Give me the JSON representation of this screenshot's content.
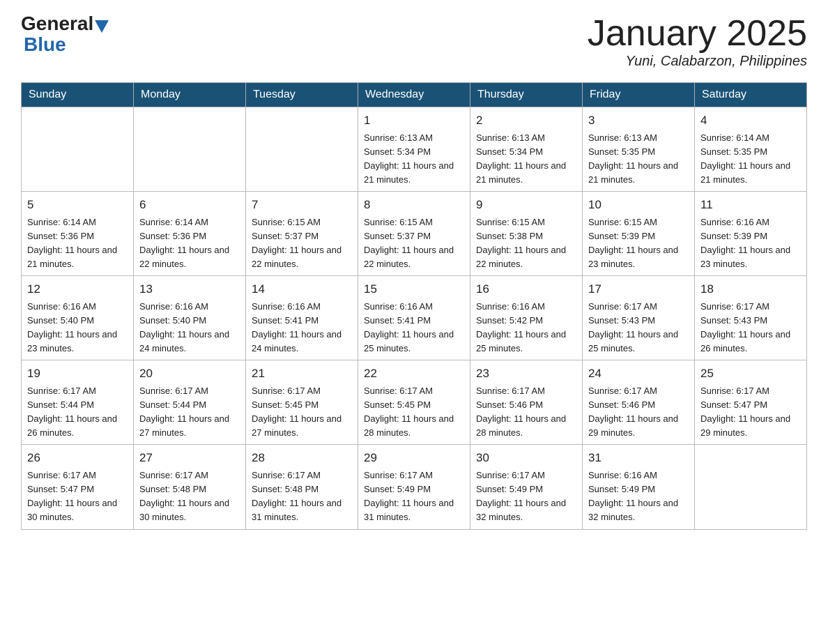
{
  "header": {
    "logo_general": "General",
    "logo_blue": "Blue",
    "month_title": "January 2025",
    "location": "Yuni, Calabarzon, Philippines"
  },
  "weekdays": [
    "Sunday",
    "Monday",
    "Tuesday",
    "Wednesday",
    "Thursday",
    "Friday",
    "Saturday"
  ],
  "weeks": [
    [
      {
        "day": "",
        "info": ""
      },
      {
        "day": "",
        "info": ""
      },
      {
        "day": "",
        "info": ""
      },
      {
        "day": "1",
        "info": "Sunrise: 6:13 AM\nSunset: 5:34 PM\nDaylight: 11 hours and 21 minutes."
      },
      {
        "day": "2",
        "info": "Sunrise: 6:13 AM\nSunset: 5:34 PM\nDaylight: 11 hours and 21 minutes."
      },
      {
        "day": "3",
        "info": "Sunrise: 6:13 AM\nSunset: 5:35 PM\nDaylight: 11 hours and 21 minutes."
      },
      {
        "day": "4",
        "info": "Sunrise: 6:14 AM\nSunset: 5:35 PM\nDaylight: 11 hours and 21 minutes."
      }
    ],
    [
      {
        "day": "5",
        "info": "Sunrise: 6:14 AM\nSunset: 5:36 PM\nDaylight: 11 hours and 21 minutes."
      },
      {
        "day": "6",
        "info": "Sunrise: 6:14 AM\nSunset: 5:36 PM\nDaylight: 11 hours and 22 minutes."
      },
      {
        "day": "7",
        "info": "Sunrise: 6:15 AM\nSunset: 5:37 PM\nDaylight: 11 hours and 22 minutes."
      },
      {
        "day": "8",
        "info": "Sunrise: 6:15 AM\nSunset: 5:37 PM\nDaylight: 11 hours and 22 minutes."
      },
      {
        "day": "9",
        "info": "Sunrise: 6:15 AM\nSunset: 5:38 PM\nDaylight: 11 hours and 22 minutes."
      },
      {
        "day": "10",
        "info": "Sunrise: 6:15 AM\nSunset: 5:39 PM\nDaylight: 11 hours and 23 minutes."
      },
      {
        "day": "11",
        "info": "Sunrise: 6:16 AM\nSunset: 5:39 PM\nDaylight: 11 hours and 23 minutes."
      }
    ],
    [
      {
        "day": "12",
        "info": "Sunrise: 6:16 AM\nSunset: 5:40 PM\nDaylight: 11 hours and 23 minutes."
      },
      {
        "day": "13",
        "info": "Sunrise: 6:16 AM\nSunset: 5:40 PM\nDaylight: 11 hours and 24 minutes."
      },
      {
        "day": "14",
        "info": "Sunrise: 6:16 AM\nSunset: 5:41 PM\nDaylight: 11 hours and 24 minutes."
      },
      {
        "day": "15",
        "info": "Sunrise: 6:16 AM\nSunset: 5:41 PM\nDaylight: 11 hours and 25 minutes."
      },
      {
        "day": "16",
        "info": "Sunrise: 6:16 AM\nSunset: 5:42 PM\nDaylight: 11 hours and 25 minutes."
      },
      {
        "day": "17",
        "info": "Sunrise: 6:17 AM\nSunset: 5:43 PM\nDaylight: 11 hours and 25 minutes."
      },
      {
        "day": "18",
        "info": "Sunrise: 6:17 AM\nSunset: 5:43 PM\nDaylight: 11 hours and 26 minutes."
      }
    ],
    [
      {
        "day": "19",
        "info": "Sunrise: 6:17 AM\nSunset: 5:44 PM\nDaylight: 11 hours and 26 minutes."
      },
      {
        "day": "20",
        "info": "Sunrise: 6:17 AM\nSunset: 5:44 PM\nDaylight: 11 hours and 27 minutes."
      },
      {
        "day": "21",
        "info": "Sunrise: 6:17 AM\nSunset: 5:45 PM\nDaylight: 11 hours and 27 minutes."
      },
      {
        "day": "22",
        "info": "Sunrise: 6:17 AM\nSunset: 5:45 PM\nDaylight: 11 hours and 28 minutes."
      },
      {
        "day": "23",
        "info": "Sunrise: 6:17 AM\nSunset: 5:46 PM\nDaylight: 11 hours and 28 minutes."
      },
      {
        "day": "24",
        "info": "Sunrise: 6:17 AM\nSunset: 5:46 PM\nDaylight: 11 hours and 29 minutes."
      },
      {
        "day": "25",
        "info": "Sunrise: 6:17 AM\nSunset: 5:47 PM\nDaylight: 11 hours and 29 minutes."
      }
    ],
    [
      {
        "day": "26",
        "info": "Sunrise: 6:17 AM\nSunset: 5:47 PM\nDaylight: 11 hours and 30 minutes."
      },
      {
        "day": "27",
        "info": "Sunrise: 6:17 AM\nSunset: 5:48 PM\nDaylight: 11 hours and 30 minutes."
      },
      {
        "day": "28",
        "info": "Sunrise: 6:17 AM\nSunset: 5:48 PM\nDaylight: 11 hours and 31 minutes."
      },
      {
        "day": "29",
        "info": "Sunrise: 6:17 AM\nSunset: 5:49 PM\nDaylight: 11 hours and 31 minutes."
      },
      {
        "day": "30",
        "info": "Sunrise: 6:17 AM\nSunset: 5:49 PM\nDaylight: 11 hours and 32 minutes."
      },
      {
        "day": "31",
        "info": "Sunrise: 6:16 AM\nSunset: 5:49 PM\nDaylight: 11 hours and 32 minutes."
      },
      {
        "day": "",
        "info": ""
      }
    ]
  ]
}
